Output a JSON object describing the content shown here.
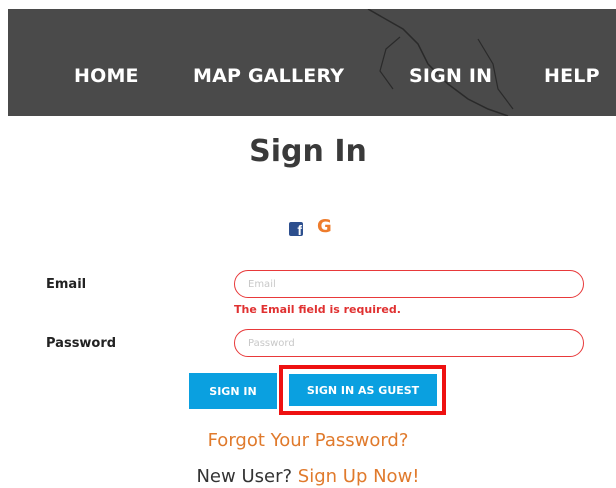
{
  "nav": {
    "items": [
      {
        "label": "HOME"
      },
      {
        "label": "MAP GALLERY"
      },
      {
        "label": "SIGN IN"
      },
      {
        "label": "HELP"
      }
    ]
  },
  "page": {
    "title": "Sign In"
  },
  "social": {
    "facebook_icon": "facebook-icon",
    "google_icon": "google-icon",
    "facebook_glyph": "f",
    "google_glyph": "G",
    "google_color": "#ee7c2c",
    "facebook_color": "#2d4f8e"
  },
  "form": {
    "email_label": "Email",
    "email_placeholder": "Email",
    "email_error": "The Email field is required.",
    "password_label": "Password",
    "password_placeholder": "Password"
  },
  "buttons": {
    "sign_in": "SIGN IN",
    "sign_in_guest": "SIGN IN AS GUEST",
    "accent_color": "#0aa0e0"
  },
  "links": {
    "forgot_password": "Forgot Your Password?",
    "new_user": "New User?",
    "sign_up": "Sign Up Now!"
  },
  "colors": {
    "error": "#e03131",
    "highlight": "#ee1111",
    "link": "#e07a2c",
    "navbar": "#4a4a4a"
  }
}
